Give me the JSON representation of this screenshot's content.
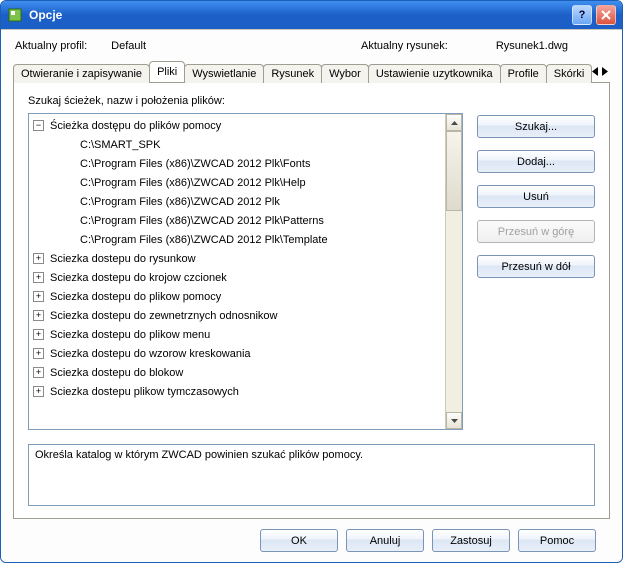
{
  "window": {
    "title": "Opcje"
  },
  "profile": {
    "current_label": "Aktualny profil:",
    "current_value": "Default",
    "drawing_label": "Aktualny rysunek:",
    "drawing_value": "Rysunek1.dwg"
  },
  "tabs": [
    {
      "label": "Otwieranie i zapisywanie"
    },
    {
      "label": "Pliki"
    },
    {
      "label": "Wyswietlanie"
    },
    {
      "label": "Rysunek"
    },
    {
      "label": "Wybor"
    },
    {
      "label": "Ustawienie uzytkownika"
    },
    {
      "label": "Profile"
    },
    {
      "label": "Skórki"
    }
  ],
  "active_tab_index": 1,
  "page": {
    "heading": "Szukaj ścieżek, nazw i położenia plików:",
    "tree": {
      "expanded": {
        "label": "Ścieżka dostępu do plików pomocy",
        "children": [
          "C:\\SMART_SPK",
          "C:\\Program Files (x86)\\ZWCAD 2012 Plk\\Fonts",
          "C:\\Program Files (x86)\\ZWCAD 2012 Plk\\Help",
          "C:\\Program Files (x86)\\ZWCAD 2012 Plk",
          "C:\\Program Files (x86)\\ZWCAD 2012 Plk\\Patterns",
          "C:\\Program Files (x86)\\ZWCAD 2012 Plk\\Template"
        ]
      },
      "collapsed": [
        "Sciezka dostepu do rysunkow",
        "Sciezka dostepu do krojow czcionek",
        "Sciezka dostepu do plikow pomocy",
        "Sciezka dostepu do zewnetrznych odnosnikow",
        "Sciezka dostepu do plikow menu",
        "Sciezka dostepu do wzorow kreskowania",
        "Sciezka dostepu do blokow",
        "Sciezka dostepu plikow tymczasowych"
      ]
    },
    "side_buttons": {
      "search": "Szukaj...",
      "add": "Dodaj...",
      "remove": "Usuń",
      "move_up": "Przesuń w górę",
      "move_down": "Przesuń w dół"
    },
    "description": "Określa katalog w którym ZWCAD powinien szukać plików pomocy."
  },
  "footer": {
    "ok": "OK",
    "cancel": "Anuluj",
    "apply": "Zastosuj",
    "help": "Pomoc"
  }
}
